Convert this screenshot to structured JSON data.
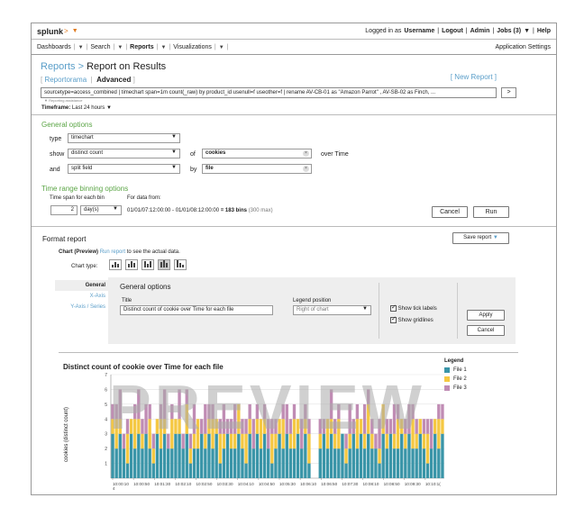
{
  "topbar": {
    "logo": "splunk",
    "logo_suffix": ">",
    "logged_in_prefix": "Logged in as",
    "username": "Username",
    "logout": "Logout",
    "admin": "Admin",
    "jobs": "Jobs (3)",
    "help": "Help"
  },
  "nav": {
    "dashboards": "Dashboards",
    "search": "Search",
    "reports": "Reports",
    "visualizations": "Visualizations",
    "app_settings": "Application Settings"
  },
  "page": {
    "crumb": "Reports",
    "crumb_sep": ">",
    "title": "Report on Results",
    "tab_reportorama": "Reportorama",
    "tab_advanced": "Advanced",
    "new_report": "New Report"
  },
  "search": {
    "query": "sourcetype=access_combined | timechart span=1m count(_raw) by product_id usenull=f useother=f | rename AV-CB-01 as \"Amazon Parrot\" , AV-SB-02 as Finch, ...",
    "assistant": "Reporting assistance",
    "go": ">",
    "timeframe_label": "Timeframe:",
    "timeframe_value": "Last 24 hours"
  },
  "general_options": {
    "title": "General options",
    "type_label": "type",
    "type_value": "timechart",
    "show_label": "show",
    "show_value": "distinct count",
    "of_label": "of",
    "of_value": "cookies",
    "over_time": "over Time",
    "and_label": "and",
    "and_value": "split field",
    "by_label": "by",
    "by_value": "file"
  },
  "binning": {
    "title": "Time range binning options",
    "span_label": "Time span for each bin",
    "data_from_label": "For data from:",
    "span_value": "2",
    "span_unit": "day(s)",
    "range": "01/01/07:12:00:00 - 01/01/08:12:00:00",
    "bins": "= 183 bins",
    "max": "(300 max)",
    "cancel": "Cancel",
    "run": "Run"
  },
  "format": {
    "title": "Format report",
    "save_report": "Save report",
    "chart_preview_label": "Chart (Preview)",
    "run_report_link": "Run report",
    "run_report_suffix": "to see the actual data.",
    "chart_type_label": "Chart type:",
    "tabs": [
      "General",
      "X-Axis",
      "Y-Axis / Series"
    ],
    "panel_title": "General options",
    "title_label": "Title",
    "title_value": "Distinct count of cookie over Time for each file",
    "legend_position_label": "Legend position",
    "legend_position_value": "Right of chart",
    "show_tick_labels": "Show tick labels",
    "show_gridlines": "Show gridlines",
    "apply": "Apply",
    "cancel": "Cancel"
  },
  "chart_data": {
    "type": "bar",
    "title": "Distinct count of cookie over Time for each file",
    "ylabel": "cookies (distinct count)",
    "watermark": "PREVIEW",
    "legend_title": "Legend",
    "legend_position": "right",
    "ylim": [
      0,
      7
    ],
    "yticks": [
      "7",
      "6",
      "5",
      "4",
      "3",
      "2",
      "1"
    ],
    "xticks": [
      "10:00:10",
      "10:00:50",
      "10:01:30",
      "10:02:10",
      "10:02:50",
      "10:03:30",
      "10:04:10",
      "10:04:50",
      "10:05:30",
      "10:06:10",
      "10:06:50",
      "10:07:30",
      "10:08:10",
      "10:08:50",
      "10:09:30",
      "10:10:1("
    ],
    "xtick_sub": [
      "4",
      "SEP",
      "2009"
    ],
    "colors": {
      "File 1": "#3a95a8",
      "File 2": "#f5c842",
      "File 3": "#c08cb4"
    },
    "series": [
      {
        "name": "File 1",
        "values": [
          3,
          2,
          3,
          2,
          1,
          3,
          2,
          3,
          2,
          3,
          2,
          1,
          3,
          2,
          3,
          2,
          2,
          3,
          3,
          2,
          3,
          1,
          2,
          2,
          3,
          2,
          3,
          2,
          3,
          1,
          2,
          3,
          2,
          2,
          3,
          2,
          1,
          3,
          2,
          3,
          2,
          3,
          2,
          1,
          2,
          3,
          2,
          3,
          2,
          2,
          3,
          2,
          3,
          1,
          0,
          0,
          2,
          3,
          2,
          3,
          2,
          2,
          3,
          1,
          2,
          3,
          2,
          3,
          2,
          3,
          2,
          2,
          1,
          3,
          2,
          3,
          2,
          2,
          3,
          2,
          3,
          2,
          2,
          3,
          2,
          1,
          2,
          3,
          2,
          3
        ]
      },
      {
        "name": "File 2",
        "values": [
          1,
          2,
          1,
          0,
          2,
          1,
          2,
          1,
          1,
          0,
          2,
          1,
          1,
          2,
          1,
          0,
          2,
          1,
          1,
          0,
          2,
          1,
          1,
          2,
          0,
          1,
          1,
          2,
          1,
          2,
          1,
          0,
          1,
          1,
          2,
          1,
          2,
          1,
          0,
          1,
          2,
          1,
          0,
          2,
          1,
          1,
          2,
          0,
          1,
          2,
          1,
          0,
          1,
          2,
          0,
          0,
          1,
          0,
          2,
          1,
          1,
          2,
          0,
          1,
          1,
          0,
          2,
          1,
          1,
          2,
          1,
          0,
          1,
          2,
          1,
          0,
          1,
          2,
          1,
          1,
          0,
          2,
          1,
          1,
          1,
          2,
          0,
          1,
          2,
          1
        ]
      },
      {
        "name": "File 3",
        "values": [
          1,
          1,
          2,
          1,
          1,
          0,
          1,
          2,
          1,
          2,
          1,
          1,
          0,
          1,
          2,
          1,
          1,
          0,
          2,
          1,
          1,
          1,
          2,
          0,
          1,
          2,
          1,
          1,
          0,
          1,
          2,
          1,
          1,
          2,
          0,
          1,
          1,
          1,
          2,
          1,
          0,
          1,
          2,
          1,
          1,
          0,
          1,
          2,
          1,
          1,
          0,
          2,
          1,
          1,
          0,
          0,
          1,
          1,
          0,
          2,
          1,
          1,
          0,
          1,
          2,
          1,
          1,
          0,
          2,
          1,
          1,
          1,
          2,
          0,
          1,
          1,
          2,
          1,
          0,
          1,
          2,
          1,
          1,
          0,
          1,
          1,
          2,
          0,
          1,
          1
        ]
      }
    ]
  }
}
